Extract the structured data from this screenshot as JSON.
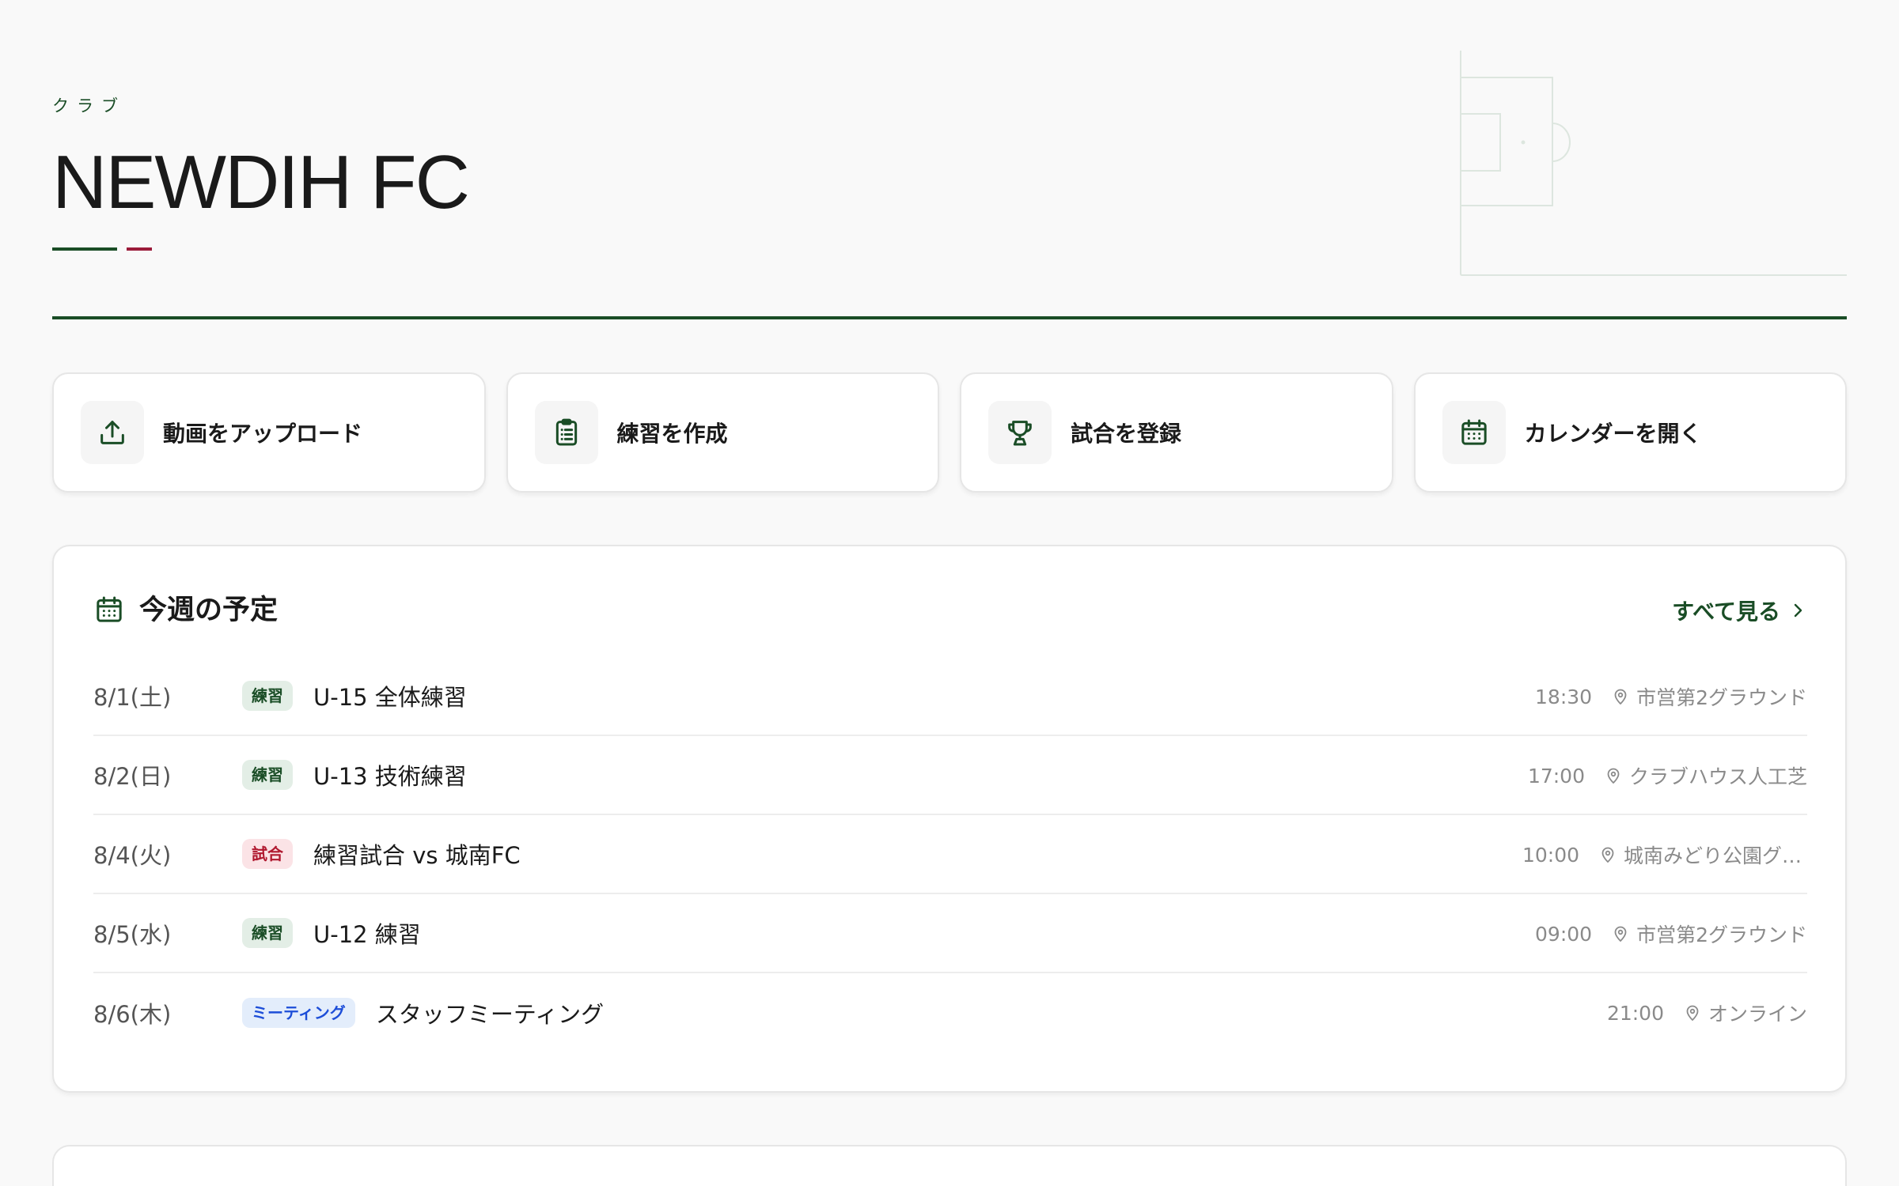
{
  "header": {
    "eyebrow": "クラブ",
    "club_name": "NEWDIH FC"
  },
  "actions": [
    {
      "label": "動画をアップロード",
      "icon": "upload-icon"
    },
    {
      "label": "練習を作成",
      "icon": "clipboard-icon"
    },
    {
      "label": "試合を登録",
      "icon": "trophy-icon"
    },
    {
      "label": "カレンダーを開く",
      "icon": "calendar-icon"
    }
  ],
  "schedule": {
    "title": "今週の予定",
    "see_all": "すべて見る",
    "rows": [
      {
        "date": "8/1(土)",
        "badge": "練習",
        "badge_type": "practice",
        "title": "U-15 全体練習",
        "time": "18:30",
        "place": "市営第2グラウンド"
      },
      {
        "date": "8/2(日)",
        "badge": "練習",
        "badge_type": "practice",
        "title": "U-13 技術練習",
        "time": "17:00",
        "place": "クラブハウス人工芝"
      },
      {
        "date": "8/4(火)",
        "badge": "試合",
        "badge_type": "match",
        "title": "練習試合 vs 城南FC",
        "time": "10:00",
        "place": "城南みどり公園グラウンド"
      },
      {
        "date": "8/5(水)",
        "badge": "練習",
        "badge_type": "practice",
        "title": "U-12 練習",
        "time": "09:00",
        "place": "市営第2グラウンド"
      },
      {
        "date": "8/6(木)",
        "badge": "ミーティング",
        "badge_type": "meeting",
        "title": "スタッフミーティング",
        "time": "21:00",
        "place": "オンライン"
      }
    ]
  },
  "colors": {
    "brand_green": "#1a4d26",
    "accent_red": "#9b1b3a",
    "match_red": "#b0182f",
    "meeting_blue": "#1d4ed8"
  }
}
